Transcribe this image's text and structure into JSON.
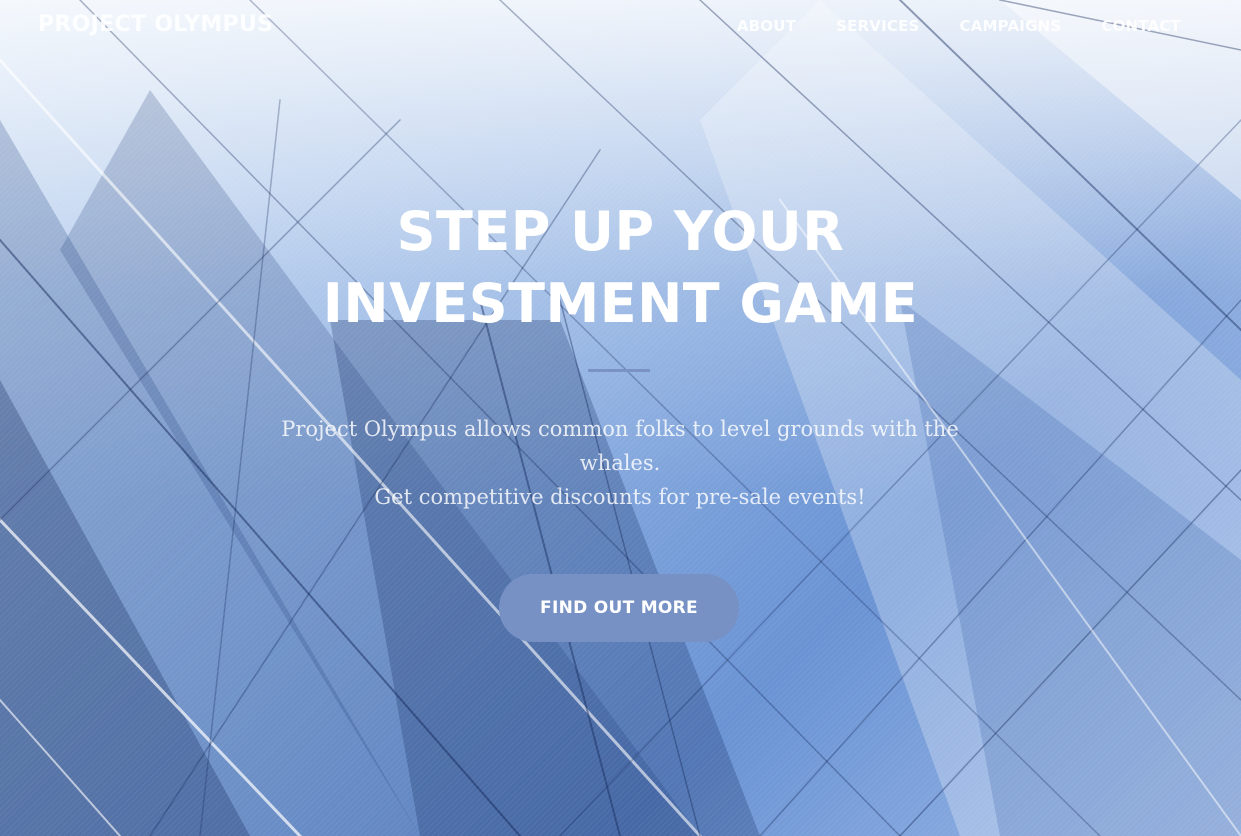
{
  "brand": "PROJECT OLYMPUS",
  "nav": {
    "items": [
      {
        "label": "ABOUT"
      },
      {
        "label": "SERVICES"
      },
      {
        "label": "CAMPAIGNS"
      },
      {
        "label": "CONTACT"
      }
    ]
  },
  "hero": {
    "headline_line1": "STEP UP YOUR",
    "headline_line2": "INVESTMENT GAME",
    "subtext_line1": "Project Olympus allows common folks to level grounds with the whales.",
    "subtext_line2": "Get competitive discounts for pre-sale events!",
    "cta_label": "FIND OUT MORE"
  },
  "colors": {
    "accent": "#7791c4",
    "divider": "#7a93c4",
    "text": "#ffffff"
  }
}
